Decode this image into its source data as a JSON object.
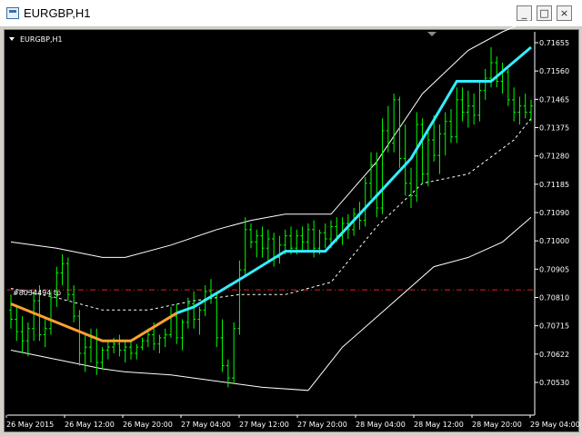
{
  "window": {
    "title": "EURGBP,H1",
    "buttons": {
      "minimize": "_",
      "maximize": "□",
      "close": "×"
    }
  },
  "chart_data": {
    "type": "candlestick",
    "symbol_label": "EURGBP,H1",
    "order_label": "#8034494 tp",
    "tp_level": 0.70885,
    "y_ticks": [
      "0.71655",
      "0.71560",
      "0.71465",
      "0.71375",
      "0.71280",
      "0.71185",
      "0.71090",
      "0.71000",
      "0.70905",
      "0.70810",
      "0.70715",
      "0.70622",
      "0.70530"
    ],
    "x_ticks": [
      "26 May 2015",
      "26 May 12:00",
      "26 May 20:00",
      "27 May 04:00",
      "27 May 12:00",
      "27 May 20:00",
      "28 May 04:00",
      "28 May 12:00",
      "28 May 20:00",
      "29 May 04:00"
    ],
    "ylim": [
      0.7048,
      0.7172
    ],
    "colors": {
      "background": "#000000",
      "candles": "#00ff00",
      "axis": "#ffffff",
      "envelope": "#ffffff",
      "ma_up": "#33eeff",
      "ma_down": "#ffa030",
      "tp_line": "#dd2222"
    },
    "candles": [
      [
        0.7082,
        0.7087,
        0.7076,
        0.7079
      ],
      [
        0.7079,
        0.7083,
        0.7072,
        0.7075
      ],
      [
        0.7075,
        0.708,
        0.7068,
        0.7072
      ],
      [
        0.7072,
        0.7078,
        0.7067,
        0.7076
      ],
      [
        0.7076,
        0.7088,
        0.7072,
        0.7085
      ],
      [
        0.7085,
        0.709,
        0.7072,
        0.7074
      ],
      [
        0.7074,
        0.7079,
        0.707,
        0.7076
      ],
      [
        0.7076,
        0.7088,
        0.7074,
        0.7086
      ],
      [
        0.7086,
        0.7096,
        0.7083,
        0.7094
      ],
      [
        0.7094,
        0.71,
        0.709,
        0.7097
      ],
      [
        0.7097,
        0.7099,
        0.7085,
        0.7087
      ],
      [
        0.7087,
        0.709,
        0.7078,
        0.708
      ],
      [
        0.708,
        0.7082,
        0.7064,
        0.7068
      ],
      [
        0.7068,
        0.7074,
        0.7062,
        0.707
      ],
      [
        0.707,
        0.7076,
        0.7065,
        0.7073
      ],
      [
        0.7073,
        0.7076,
        0.7061,
        0.7065
      ],
      [
        0.7065,
        0.707,
        0.7063,
        0.7069
      ],
      [
        0.7069,
        0.7072,
        0.7066,
        0.707
      ],
      [
        0.707,
        0.7073,
        0.7068,
        0.7071
      ],
      [
        0.7071,
        0.7074,
        0.7067,
        0.7069
      ],
      [
        0.7069,
        0.7072,
        0.7065,
        0.707
      ],
      [
        0.707,
        0.7072,
        0.7066,
        0.7068
      ],
      [
        0.7068,
        0.7071,
        0.7066,
        0.707
      ],
      [
        0.707,
        0.7073,
        0.7069,
        0.7072
      ],
      [
        0.7072,
        0.7076,
        0.707,
        0.7074
      ],
      [
        0.7074,
        0.7078,
        0.7069,
        0.7071
      ],
      [
        0.7071,
        0.7074,
        0.7068,
        0.7073
      ],
      [
        0.7073,
        0.7076,
        0.707,
        0.7074
      ],
      [
        0.7074,
        0.7083,
        0.7073,
        0.708
      ],
      [
        0.708,
        0.7084,
        0.7071,
        0.7073
      ],
      [
        0.7073,
        0.7079,
        0.7069,
        0.7078
      ],
      [
        0.7078,
        0.7086,
        0.7076,
        0.7084
      ],
      [
        0.7084,
        0.7088,
        0.7076,
        0.7079
      ],
      [
        0.7079,
        0.7083,
        0.7074,
        0.7082
      ],
      [
        0.7082,
        0.709,
        0.708,
        0.7088
      ],
      [
        0.7088,
        0.7092,
        0.7084,
        0.7087
      ],
      [
        0.7087,
        0.7088,
        0.707,
        0.7073
      ],
      [
        0.7073,
        0.7079,
        0.7062,
        0.7064
      ],
      [
        0.7064,
        0.7066,
        0.7057,
        0.706
      ],
      [
        0.706,
        0.7078,
        0.7058,
        0.7076
      ],
      [
        0.7076,
        0.7098,
        0.7074,
        0.7095
      ],
      [
        0.7095,
        0.7112,
        0.7093,
        0.7108
      ],
      [
        0.7108,
        0.711,
        0.7102,
        0.7104
      ],
      [
        0.7104,
        0.7108,
        0.7099,
        0.7106
      ],
      [
        0.7106,
        0.7109,
        0.7099,
        0.7102
      ],
      [
        0.7102,
        0.7108,
        0.7098,
        0.7105
      ],
      [
        0.7105,
        0.7107,
        0.7096,
        0.7099
      ],
      [
        0.7099,
        0.7106,
        0.7097,
        0.7103
      ],
      [
        0.7103,
        0.7108,
        0.71,
        0.7106
      ],
      [
        0.7106,
        0.7109,
        0.71,
        0.7102
      ],
      [
        0.7102,
        0.7108,
        0.71,
        0.7106
      ],
      [
        0.7106,
        0.7109,
        0.7101,
        0.7104
      ],
      [
        0.7104,
        0.711,
        0.7101,
        0.7108
      ],
      [
        0.7108,
        0.7111,
        0.7099,
        0.7102
      ],
      [
        0.7102,
        0.7108,
        0.71,
        0.7107
      ],
      [
        0.7107,
        0.711,
        0.7102,
        0.7105
      ],
      [
        0.7105,
        0.7111,
        0.7102,
        0.7109
      ],
      [
        0.7109,
        0.7112,
        0.7104,
        0.7106
      ],
      [
        0.7106,
        0.7112,
        0.7103,
        0.711
      ],
      [
        0.711,
        0.7113,
        0.7105,
        0.7108
      ],
      [
        0.7108,
        0.7115,
        0.7106,
        0.7113
      ],
      [
        0.7113,
        0.7117,
        0.7108,
        0.7111
      ],
      [
        0.7111,
        0.7125,
        0.7109,
        0.7123
      ],
      [
        0.7123,
        0.7133,
        0.7118,
        0.7129
      ],
      [
        0.7129,
        0.7133,
        0.7112,
        0.7115
      ],
      [
        0.7115,
        0.7144,
        0.7113,
        0.714
      ],
      [
        0.714,
        0.7148,
        0.7133,
        0.7136
      ],
      [
        0.7136,
        0.7152,
        0.7133,
        0.715
      ],
      [
        0.715,
        0.7151,
        0.7128,
        0.7131
      ],
      [
        0.7131,
        0.7142,
        0.7119,
        0.7123
      ],
      [
        0.7123,
        0.7128,
        0.7115,
        0.7119
      ],
      [
        0.7119,
        0.7146,
        0.7117,
        0.7142
      ],
      [
        0.7142,
        0.7144,
        0.7123,
        0.7126
      ],
      [
        0.7126,
        0.714,
        0.7122,
        0.7137
      ],
      [
        0.7137,
        0.7145,
        0.713,
        0.7132
      ],
      [
        0.7132,
        0.7142,
        0.7126,
        0.7139
      ],
      [
        0.7139,
        0.7146,
        0.7132,
        0.7143
      ],
      [
        0.7143,
        0.7147,
        0.7136,
        0.7138
      ],
      [
        0.7138,
        0.7154,
        0.7136,
        0.715
      ],
      [
        0.715,
        0.7154,
        0.7143,
        0.7146
      ],
      [
        0.7146,
        0.7153,
        0.7141,
        0.7148
      ],
      [
        0.7148,
        0.7152,
        0.7142,
        0.7145
      ],
      [
        0.7145,
        0.7156,
        0.7143,
        0.7153
      ],
      [
        0.7153,
        0.716,
        0.715,
        0.7157
      ],
      [
        0.7157,
        0.7167,
        0.7154,
        0.7162
      ],
      [
        0.7162,
        0.7164,
        0.7154,
        0.7156
      ],
      [
        0.7156,
        0.7162,
        0.7152,
        0.7159
      ],
      [
        0.7159,
        0.716,
        0.7148,
        0.715
      ],
      [
        0.715,
        0.7154,
        0.7143,
        0.7146
      ],
      [
        0.7146,
        0.7151,
        0.7142,
        0.7148
      ],
      [
        0.7148,
        0.7152,
        0.7144,
        0.7146
      ],
      [
        0.7146,
        0.715,
        0.7143,
        0.7148
      ]
    ],
    "ma_line": [
      [
        0,
        0.7084
      ],
      [
        8,
        0.7078
      ],
      [
        16,
        0.7072
      ],
      [
        21,
        0.7072
      ],
      [
        29,
        0.7081
      ],
      [
        32,
        0.7083
      ],
      [
        41,
        0.7093
      ],
      [
        48,
        0.7101
      ],
      [
        55,
        0.7101
      ],
      [
        70,
        0.7131
      ],
      [
        78,
        0.7156
      ],
      [
        84,
        0.7156
      ],
      [
        91,
        0.7167
      ]
    ],
    "ma_down_until": 29,
    "mid_band": [
      [
        0,
        0.7089
      ],
      [
        8,
        0.7086
      ],
      [
        16,
        0.7082
      ],
      [
        24,
        0.7082
      ],
      [
        32,
        0.7085
      ],
      [
        40,
        0.7087
      ],
      [
        48,
        0.7087
      ],
      [
        56,
        0.7091
      ],
      [
        64,
        0.7109
      ],
      [
        72,
        0.7123
      ],
      [
        80,
        0.7126
      ],
      [
        88,
        0.7137
      ],
      [
        91,
        0.7144
      ]
    ],
    "upper_band": [
      [
        0,
        0.7104
      ],
      [
        8,
        0.7102
      ],
      [
        16,
        0.7099
      ],
      [
        20,
        0.7099
      ],
      [
        28,
        0.7103
      ],
      [
        36,
        0.7108
      ],
      [
        42,
        0.7111
      ],
      [
        48,
        0.7113
      ],
      [
        56,
        0.7113
      ],
      [
        64,
        0.713
      ],
      [
        72,
        0.7152
      ],
      [
        80,
        0.7166
      ],
      [
        86,
        0.7172
      ],
      [
        91,
        0.7176
      ]
    ],
    "lower_band": [
      [
        0,
        0.7069
      ],
      [
        8,
        0.7066
      ],
      [
        16,
        0.7063
      ],
      [
        20,
        0.7062
      ],
      [
        28,
        0.7061
      ],
      [
        36,
        0.7059
      ],
      [
        44,
        0.7057
      ],
      [
        52,
        0.7056
      ],
      [
        58,
        0.707
      ],
      [
        66,
        0.7083
      ],
      [
        74,
        0.7096
      ],
      [
        80,
        0.7099
      ],
      [
        86,
        0.7104
      ],
      [
        91,
        0.7112
      ]
    ]
  }
}
